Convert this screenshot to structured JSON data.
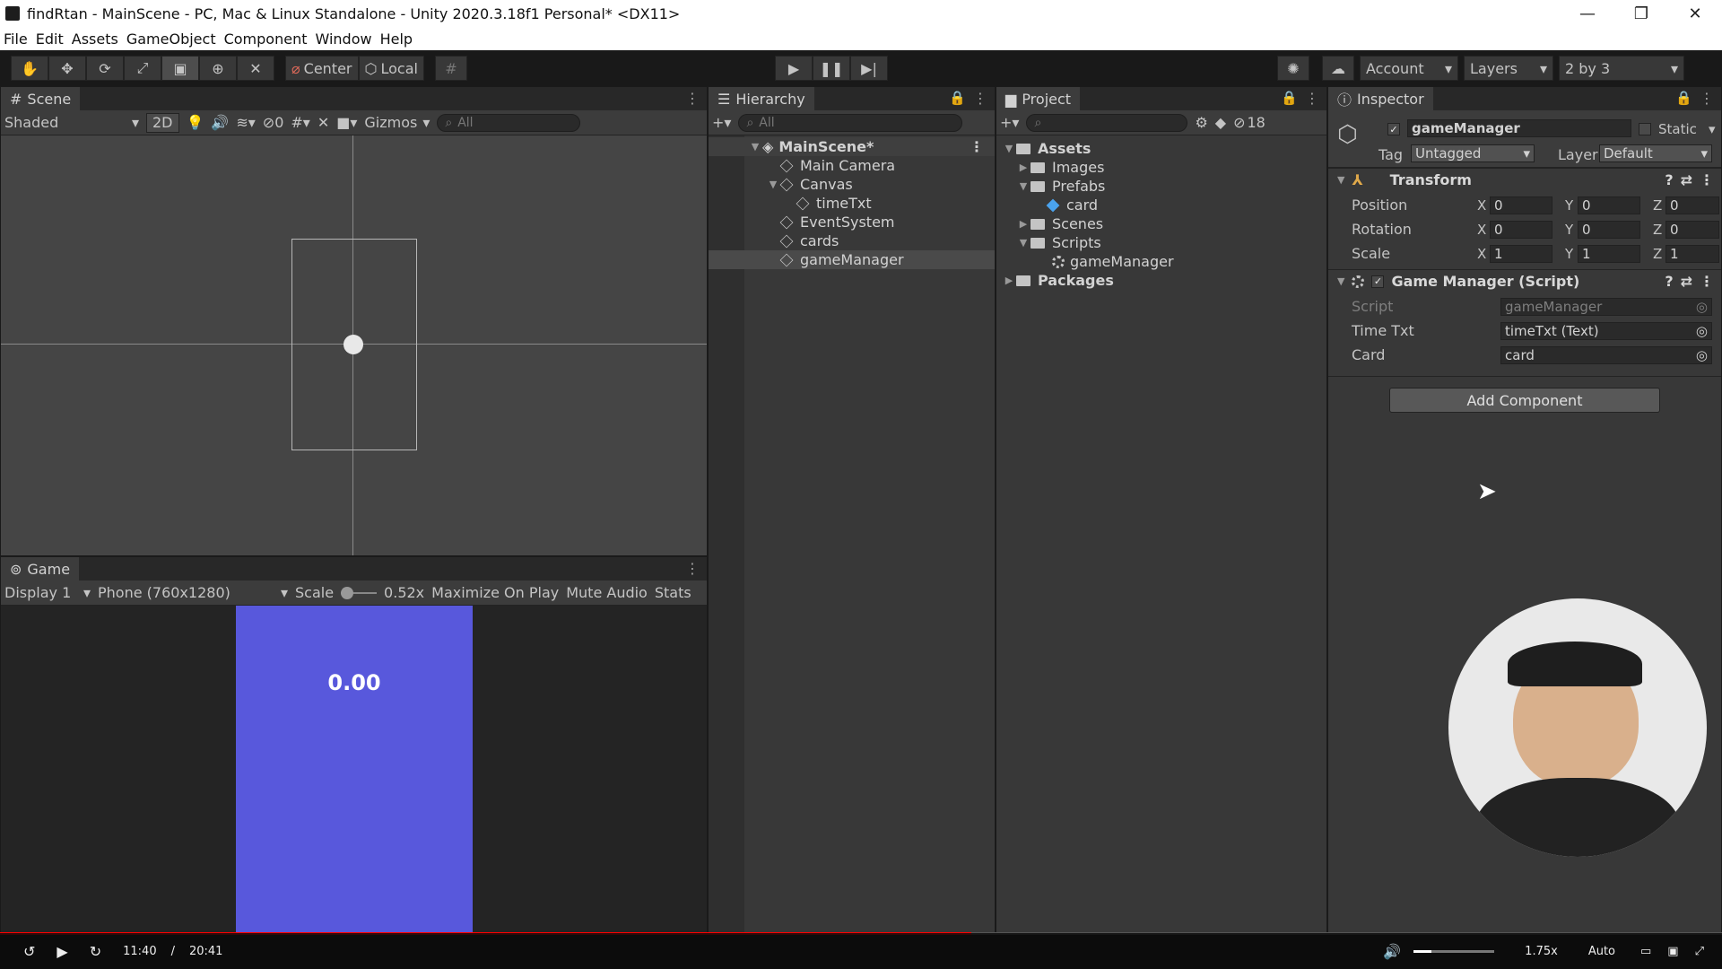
{
  "window": {
    "title": "findRtan - MainScene - PC, Mac & Linux Standalone - Unity 2020.3.18f1 Personal* <DX11>",
    "minimize": "—",
    "maximize": "❐",
    "close": "✕"
  },
  "menu": [
    "File",
    "Edit",
    "Assets",
    "GameObject",
    "Component",
    "Window",
    "Help"
  ],
  "toolbar": {
    "center": "Center",
    "local": "Local",
    "account": "Account",
    "layers": "Layers",
    "layout": "2 by 3"
  },
  "scene": {
    "tab": "Scene",
    "shading": "Shaded",
    "mode2d": "2D",
    "hidden_count": "0",
    "gizmos": "Gizmos",
    "search_placeholder": "All"
  },
  "game": {
    "tab": "Game",
    "display": "Display 1",
    "resolution": "Phone (760x1280)",
    "scale_label": "Scale",
    "scale_value": "0.52x",
    "maximize": "Maximize On Play",
    "mute": "Mute Audio",
    "stats": "Stats",
    "timer_text": "0.00",
    "bg_color": "#5858dc"
  },
  "hierarchy": {
    "tab": "Hierarchy",
    "search_placeholder": "All",
    "scene": "MainScene*",
    "items": [
      "Main Camera",
      "Canvas",
      "timeTxt",
      "EventSystem",
      "cards",
      "gameManager"
    ]
  },
  "project": {
    "tab": "Project",
    "hidden_count": "18",
    "items": [
      "Assets",
      "Images",
      "Prefabs",
      "card",
      "Scenes",
      "Scripts",
      "gameManager",
      "Packages"
    ]
  },
  "inspector": {
    "tab": "Inspector",
    "object_name": "gameManager",
    "static": "Static",
    "tag_label": "Tag",
    "tag_value": "Untagged",
    "layer_label": "Layer",
    "layer_value": "Default",
    "transform": {
      "title": "Transform",
      "rows": [
        {
          "label": "Position",
          "x": "0",
          "y": "0",
          "z": "0"
        },
        {
          "label": "Rotation",
          "x": "0",
          "y": "0",
          "z": "0"
        },
        {
          "label": "Scale",
          "x": "1",
          "y": "1",
          "z": "1"
        }
      ]
    },
    "script_component": {
      "title": "Game Manager (Script)",
      "rows": [
        {
          "label": "Script",
          "value": "gameManager"
        },
        {
          "label": "Time Txt",
          "value": "timeTxt (Text)"
        },
        {
          "label": "Card",
          "value": "card"
        }
      ]
    },
    "add_component": "Add Component"
  },
  "video": {
    "current": "11:40",
    "separator": "/",
    "duration": "20:41",
    "speed": "1.75x",
    "quality": "Auto",
    "progress": 0.564
  }
}
